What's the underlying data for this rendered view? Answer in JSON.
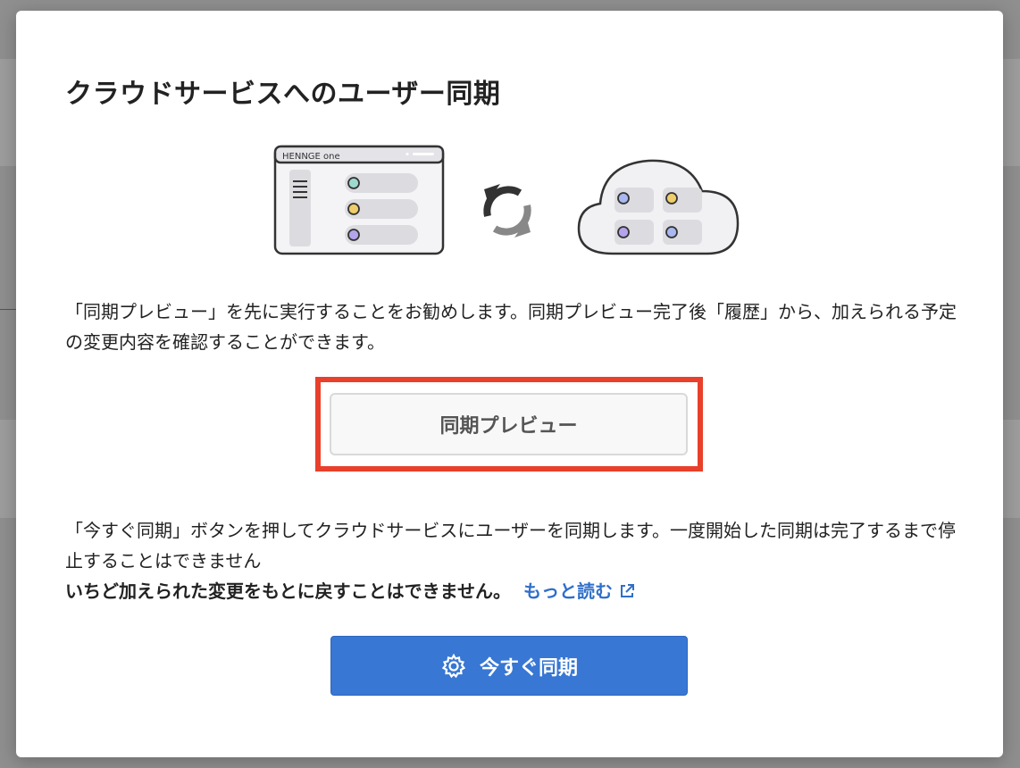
{
  "modal": {
    "title": "クラウドサービスへのユーザー同期",
    "illustration": {
      "app_window_label": "HENNGE one",
      "icons": [
        "app-window-icon",
        "sync-arrows-icon",
        "cloud-icon"
      ]
    },
    "intro_text": "「同期プレビュー」を先に実行することをお勧めします。同期プレビュー完了後「履歴」から、加えられる予定の変更内容を確認することができます。",
    "preview_button_label": "同期プレビュー",
    "sync_info_line1": "「今すぐ同期」ボタンを押してクラウドサービスにユーザーを同期します。一度開始した同期は完了するまで停止することはできません",
    "sync_warning_bold": "いちど加えられた変更をもとに戻すことはできません。",
    "read_more_label": "もっと読む",
    "sync_button_label": "今すぐ同期"
  },
  "colors": {
    "primary_blue": "#3877d3",
    "link_blue": "#2f6fc9",
    "highlight_red": "#e8402a",
    "overlay_gray": "#8f8f8f"
  }
}
